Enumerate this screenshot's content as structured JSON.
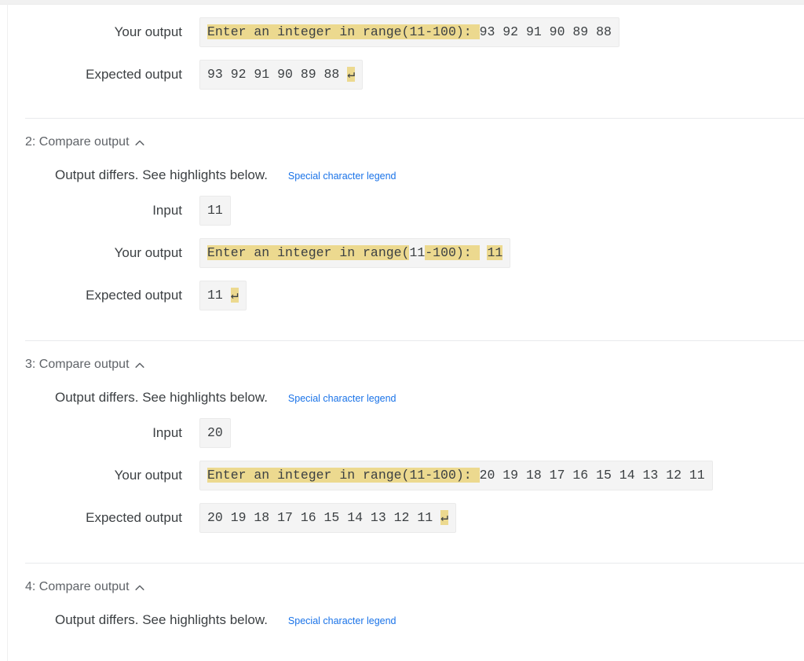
{
  "labels": {
    "input": "Input",
    "your_output": "Your output",
    "expected_output": "Expected output",
    "differs_text": "Output differs. See highlights below.",
    "legend_link": "Special character legend",
    "collapse_icon": "chevron-up-icon",
    "newline_glyph": "↵"
  },
  "colors": {
    "highlight": "#ecd98f",
    "box_background": "#f4f4f4",
    "link": "#1a73e8",
    "heading_text": "#5f6368",
    "body_text": "#3c4043",
    "divider": "#e8eaed"
  },
  "tests": [
    {
      "heading": "",
      "your_output_segments": [
        {
          "text": "Enter an integer in range(11-100): ",
          "highlight": true
        },
        {
          "text": "93 92 91 90 89 88",
          "highlight": false
        }
      ],
      "expected_output_segments": [
        {
          "text": "93 92 91 90 89 88 ",
          "highlight": false
        },
        {
          "text": "↵",
          "highlight": true
        }
      ]
    },
    {
      "heading": "2: Compare output",
      "input": "11",
      "your_output_segments": [
        {
          "text": "Enter an integer in range(",
          "highlight": true
        },
        {
          "text": "11",
          "highlight": false
        },
        {
          "text": "-100): ",
          "highlight": true
        },
        {
          "text": " ",
          "highlight": false
        },
        {
          "text": "11",
          "highlight": true
        }
      ],
      "expected_output_segments": [
        {
          "text": "11 ",
          "highlight": false
        },
        {
          "text": "↵",
          "highlight": true
        }
      ]
    },
    {
      "heading": "3: Compare output",
      "input": "20",
      "your_output_segments": [
        {
          "text": "Enter an integer in range(11-100): ",
          "highlight": true
        },
        {
          "text": "20 19 18 17 16 15 14 13 12 11",
          "highlight": false
        }
      ],
      "expected_output_segments": [
        {
          "text": "20 19 18 17 16 15 14 13 12 11 ",
          "highlight": false
        },
        {
          "text": "↵",
          "highlight": true
        }
      ]
    },
    {
      "heading": "4: Compare output"
    }
  ]
}
